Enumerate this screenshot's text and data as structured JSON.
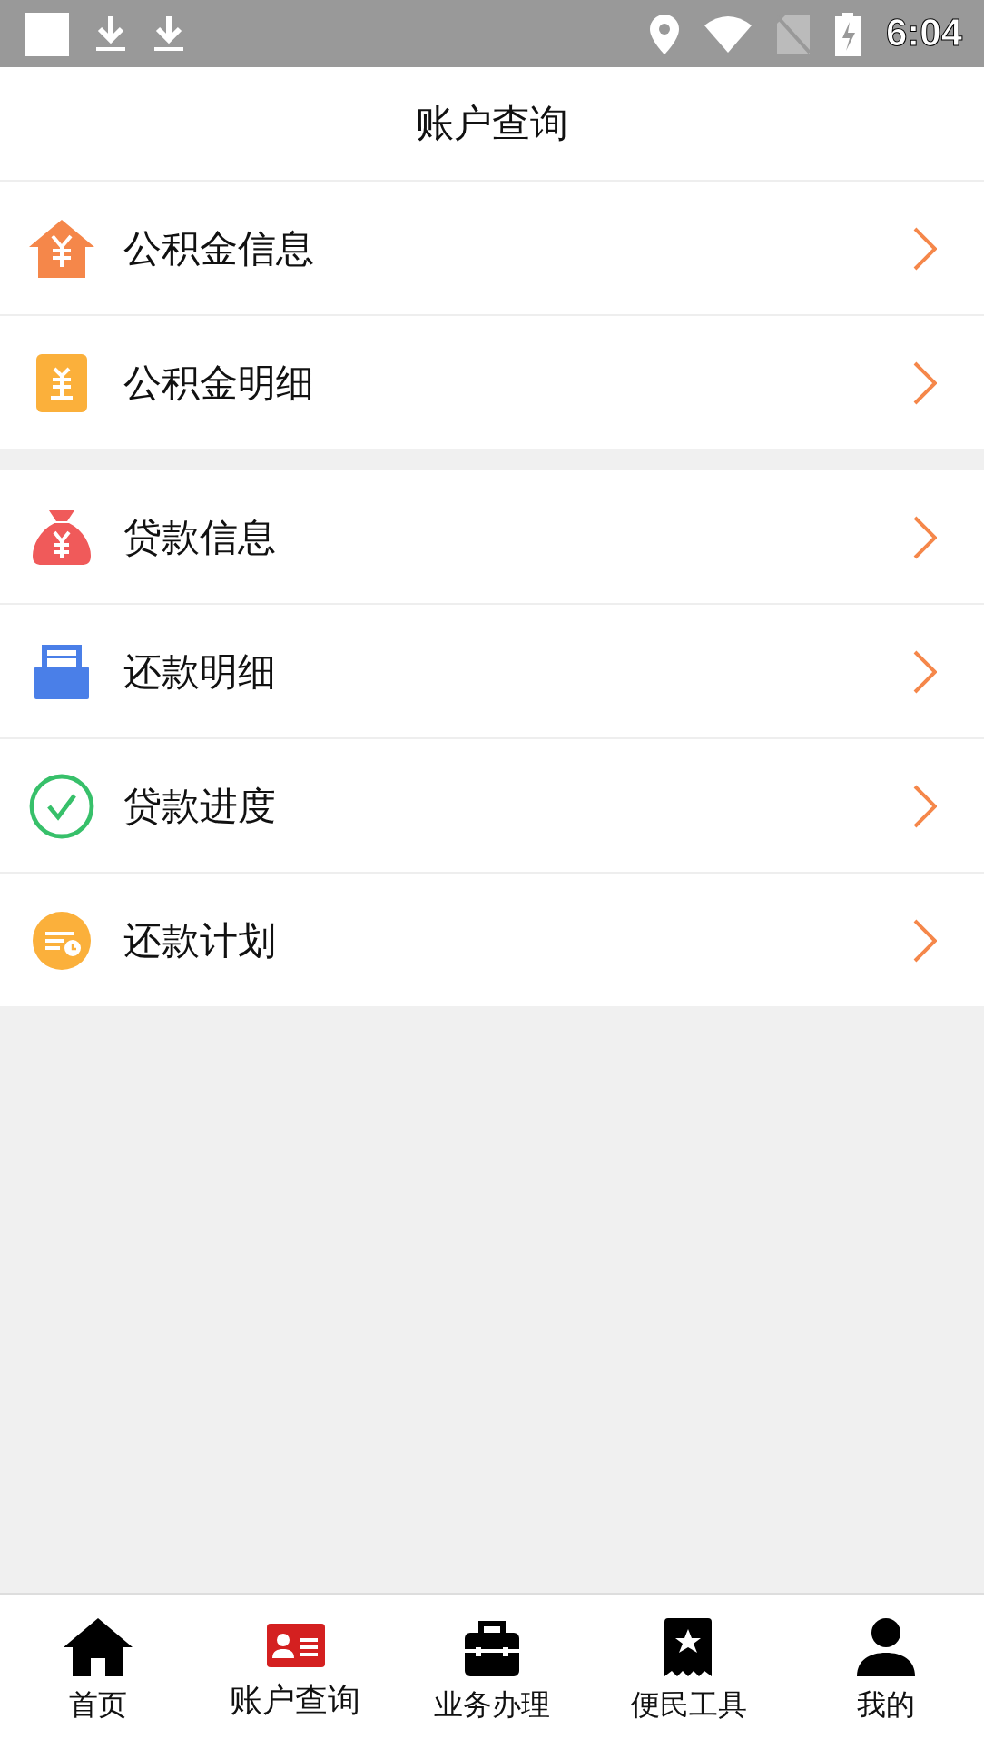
{
  "status_bar": {
    "time": "6:04"
  },
  "header": {
    "title": "账户查询"
  },
  "sections": [
    {
      "items": [
        {
          "label": "公积金信息"
        },
        {
          "label": "公积金明细"
        }
      ]
    },
    {
      "items": [
        {
          "label": "贷款信息"
        },
        {
          "label": "还款明细"
        },
        {
          "label": "贷款进度"
        },
        {
          "label": "还款计划"
        }
      ]
    }
  ],
  "tabs": [
    {
      "label": "首页",
      "selected": false
    },
    {
      "label": "账户查询",
      "selected": true
    },
    {
      "label": "业务办理",
      "selected": false
    },
    {
      "label": "便民工具",
      "selected": false
    },
    {
      "label": "我的",
      "selected": false
    }
  ]
}
